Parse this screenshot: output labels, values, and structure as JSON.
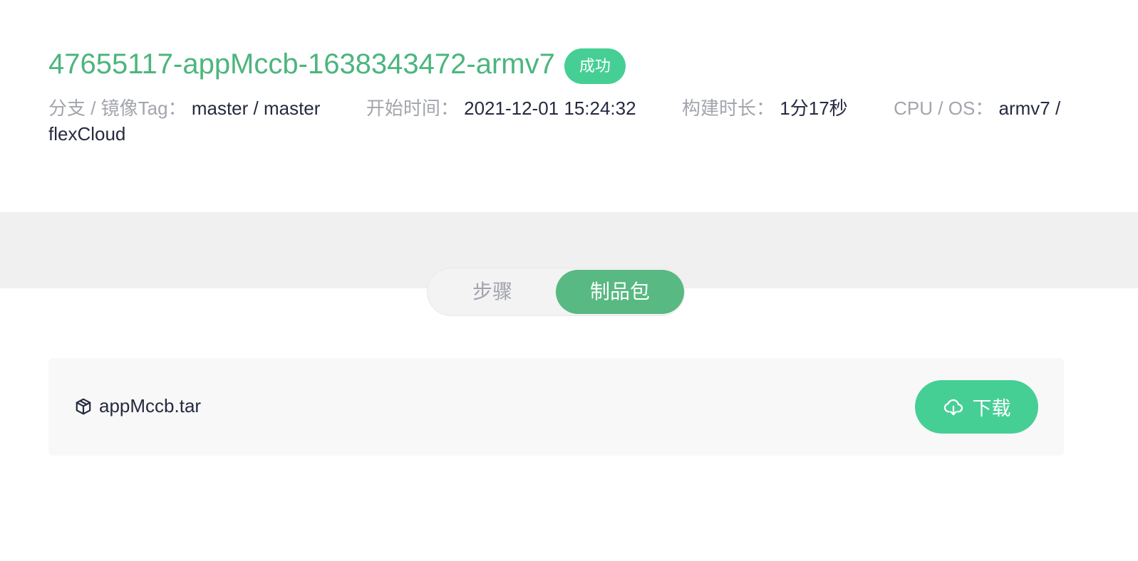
{
  "header": {
    "title": "47655117-appMccb-1638343472-armv7",
    "status": "成功",
    "meta": {
      "branch_label": "分支 / 镜像Tag：",
      "branch_value": "master / master",
      "start_label": "开始时间：",
      "start_value": "2021-12-01 15:24:32",
      "duration_label": "构建时长：",
      "duration_value": "1分17秒",
      "cpu_os_label": "CPU / OS：",
      "cpu_os_value": "armv7 / flexCloud"
    }
  },
  "tabs": [
    {
      "label": "步骤",
      "active": false
    },
    {
      "label": "制品包",
      "active": true
    }
  ],
  "artifacts": [
    {
      "name": "appMccb.tar",
      "icon": "package-icon",
      "download_label": "下载",
      "download_icon": "cloud-download-icon"
    }
  ],
  "colors": {
    "title": "#4cb57e",
    "badge": "#46cf95",
    "active_tab": "#58b982",
    "download_button": "#46cf95"
  }
}
